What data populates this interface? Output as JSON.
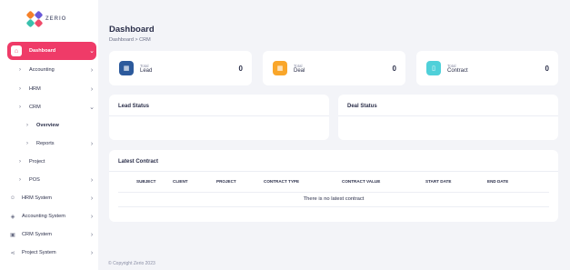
{
  "brand": {
    "name": "ZERIO"
  },
  "sidebar": {
    "items": [
      {
        "label": "Dashboard",
        "icon": "home-icon"
      },
      {
        "label": "Accounting"
      },
      {
        "label": "HRM"
      },
      {
        "label": "CRM"
      },
      {
        "label": "Overview"
      },
      {
        "label": "Reports"
      },
      {
        "label": "Project"
      },
      {
        "label": "POS"
      },
      {
        "label": "HRM System",
        "icon": "user-icon"
      },
      {
        "label": "Accounting System",
        "icon": "accounting-icon"
      },
      {
        "label": "CRM System",
        "icon": "crm-icon"
      },
      {
        "label": "Project System",
        "icon": "share-icon"
      }
    ]
  },
  "header": {
    "title": "Dashboard",
    "breadcrumb": "Dashboard  >  CRM"
  },
  "stats": [
    {
      "small": "Total",
      "label": "Lead",
      "value": "0",
      "color": "#2c5a9c"
    },
    {
      "small": "Total",
      "label": "Deal",
      "value": "0",
      "color": "#f9a62a"
    },
    {
      "small": "Total",
      "label": "Contract",
      "value": "0",
      "color": "#4fd0d9"
    }
  ],
  "panels": {
    "lead_status": "Lead Status",
    "deal_status": "Deal Status",
    "latest_contract": "Latest Contract"
  },
  "table": {
    "columns": [
      "SUBJECT",
      "CLIENT",
      "PROJECT",
      "CONTRACT TYPE",
      "CONTRACT VALUE",
      "START DATE",
      "END DATE"
    ],
    "empty": "There is no latest contract"
  },
  "footer": "© Copyright Zerio 2023"
}
